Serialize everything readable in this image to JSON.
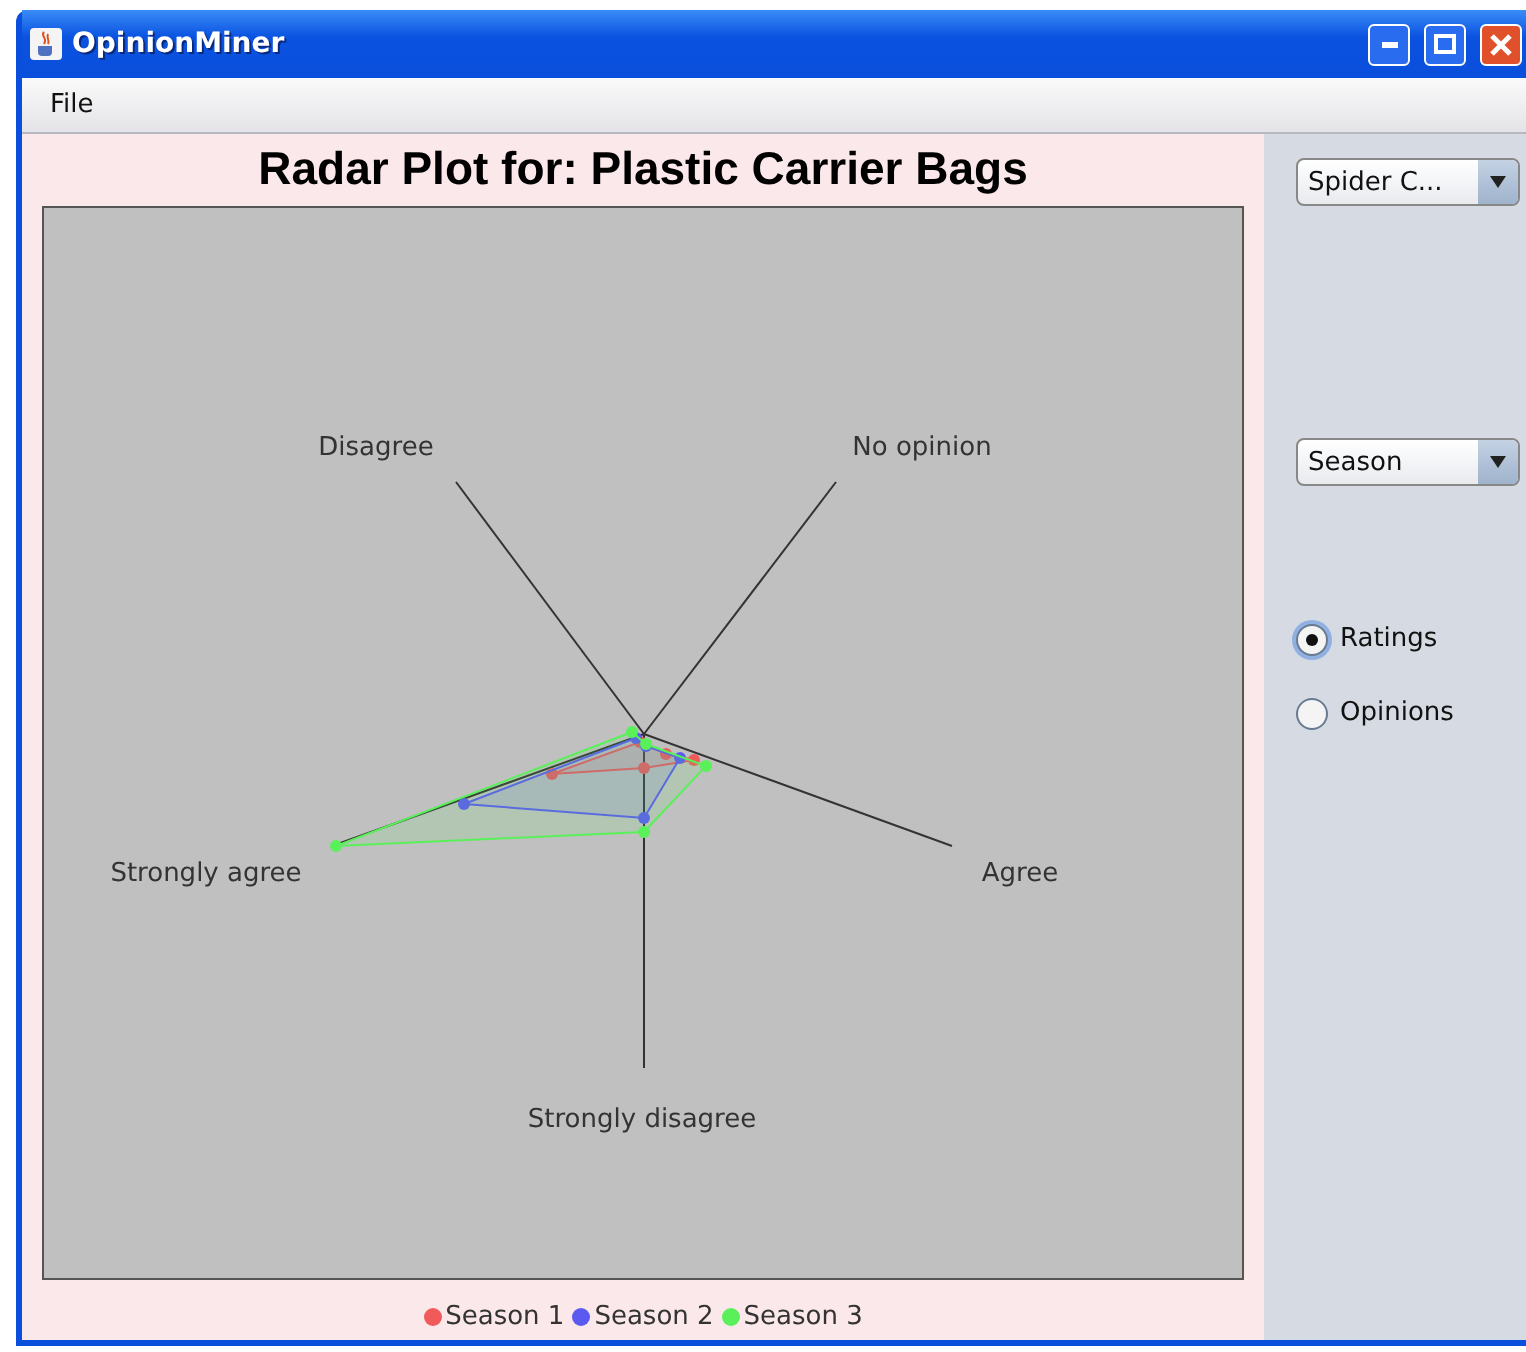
{
  "window": {
    "title": "OpinionMiner"
  },
  "menu": [
    "File"
  ],
  "chart": {
    "title": "Radar Plot for: Plastic Carrier Bags",
    "axes": [
      {
        "label": "Disagree"
      },
      {
        "label": "No opinion"
      },
      {
        "label": "Agree"
      },
      {
        "label": "Strongly disagree"
      },
      {
        "label": "Strongly agree"
      }
    ],
    "legend": [
      {
        "label": "Season 1",
        "color": "#f05a5a"
      },
      {
        "label": "Season 2",
        "color": "#5a5af0"
      },
      {
        "label": "Season 3",
        "color": "#5af05a"
      }
    ]
  },
  "controls": {
    "chart_type": {
      "value": "Spider C..."
    },
    "group_by": {
      "value": "Season"
    },
    "radios": [
      {
        "label": "Ratings",
        "selected": true
      },
      {
        "label": "Opinions",
        "selected": false
      }
    ]
  }
}
